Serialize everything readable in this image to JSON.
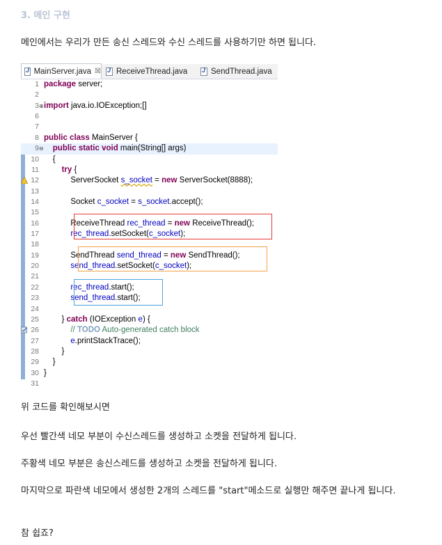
{
  "heading": "3. 메인 구현",
  "intro": "메인에서는 우리가 만든 송신 스레드와 수신 스레드를 사용하기만 하면 됩니다.",
  "tabs": [
    {
      "label": "MainServer.java",
      "close": "☒",
      "active": true
    },
    {
      "label": "ReceiveThread.java",
      "active": false
    },
    {
      "label": "SendThread.java",
      "active": false
    }
  ],
  "code_lines": [
    {
      "n": "1",
      "html": "<span class='kw'>package</span> server;"
    },
    {
      "n": "2",
      "html": ""
    },
    {
      "n": "3",
      "fold": "⊕",
      "html": "<span class='kw'>import</span> java.io.IOException;[]"
    },
    {
      "n": "6",
      "html": ""
    },
    {
      "n": "7",
      "html": ""
    },
    {
      "n": "8",
      "html": "<span class='kw'>public class</span> MainServer {"
    },
    {
      "n": "9",
      "fold": "⊖",
      "hl": true,
      "html": "    <span class='kw'>public static void</span> main(String[] args)"
    },
    {
      "n": "10",
      "html": "    {"
    },
    {
      "n": "11",
      "html": "        <span class='kw'>try</span> {"
    },
    {
      "n": "12",
      "warn": true,
      "html": "            ServerSocket <span class='var' style='text-decoration:underline wavy #d4a400'>s_socket</span> = <span class='kw'>new</span> ServerSocket(8888);"
    },
    {
      "n": "13",
      "html": ""
    },
    {
      "n": "14",
      "html": "            Socket <span class='var'>c_socket</span> = <span class='var'>s_socket</span>.accept();"
    },
    {
      "n": "15",
      "html": ""
    },
    {
      "n": "16",
      "html": "            ReceiveThread <span class='var'>rec_thread</span> = <span class='kw'>new</span> ReceiveThread();"
    },
    {
      "n": "17",
      "html": "            <span class='var'>rec_thread</span>.setSocket(<span class='var'>c_socket</span>);"
    },
    {
      "n": "18",
      "html": ""
    },
    {
      "n": "19",
      "html": "            SendThread <span class='var'>send_thread</span> = <span class='kw'>new</span> SendThread();"
    },
    {
      "n": "20",
      "html": "            <span class='var'>send_thread</span>.setSocket(<span class='var'>c_socket</span>);"
    },
    {
      "n": "21",
      "html": ""
    },
    {
      "n": "22",
      "html": "            <span class='var'>rec_thread</span>.start();"
    },
    {
      "n": "23",
      "html": "            <span class='var'>send_thread</span>.start();"
    },
    {
      "n": "24",
      "html": ""
    },
    {
      "n": "25",
      "html": "        } <span class='kw'>catch</span> (IOException <span class='var'>e</span>) {"
    },
    {
      "n": "26",
      "task": true,
      "html": "            <span class='cm'>// <span class='todo'>TODO</span> Auto-generated catch block</span>"
    },
    {
      "n": "27",
      "html": "            <span class='var'>e</span>.printStackTrace();"
    },
    {
      "n": "28",
      "html": "        }"
    },
    {
      "n": "29",
      "html": "    }"
    },
    {
      "n": "30",
      "html": "}"
    },
    {
      "n": "31",
      "html": ""
    }
  ],
  "highlight_colors": {
    "red": "#e53935",
    "orange": "#f5a04a",
    "blue": "#4aa3df"
  },
  "paragraphs": [
    "위 코드를 확인해보시면",
    "우선 빨간색 네모 부분이 수신스레드를 생성하고 소켓을 전달하게 됩니다.",
    "주황색 네모 부분은 송신스레드를 생성하고 소켓을 전달하게 됩니다.",
    "마지막으로 파란색 네모에서 생성한 2개의 스레드를 \"start\"메소드로 실행만 해주면 끝나게 됩니다.",
    "참 쉽죠?"
  ]
}
